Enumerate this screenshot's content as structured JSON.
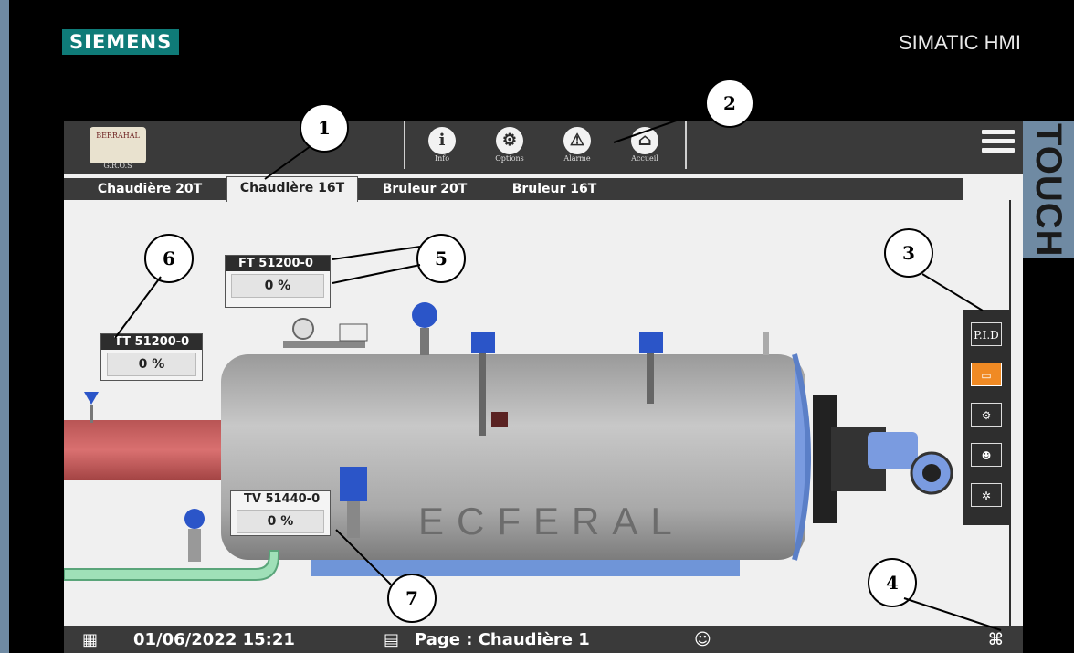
{
  "device": {
    "brand": "SIEMENS",
    "product": "SIMATIC HMI",
    "side_label": "TOUCH"
  },
  "header": {
    "logo_text": "BERRAHAL",
    "logo_sub": "G.R.O.S",
    "nav": [
      {
        "label": "Info",
        "icon": "info-icon"
      },
      {
        "label": "Options",
        "icon": "gear-icon"
      },
      {
        "label": "Alarme",
        "icon": "warning-icon"
      },
      {
        "label": "Accueil",
        "icon": "home-icon"
      }
    ]
  },
  "tabs": [
    {
      "label": "Chaudière 20T"
    },
    {
      "label": "Chaudière 16T",
      "active": true
    },
    {
      "label": "Bruleur 20T"
    },
    {
      "label": "Bruleur 16T"
    }
  ],
  "side_panel": [
    {
      "label": "P.I.D",
      "icon": "pid-icon"
    },
    {
      "label": "",
      "icon": "boiler-icon",
      "active": true
    },
    {
      "label": "",
      "icon": "burner-icon"
    },
    {
      "label": "",
      "icon": "operator-icon"
    },
    {
      "label": "",
      "icon": "conveyor-icon"
    }
  ],
  "tags": {
    "ft": {
      "name": "FT 51200-0",
      "value": "0 %"
    },
    "tt": {
      "name": "TT 51200-0",
      "value": "0 %"
    },
    "tv": {
      "name": "TV 51440-0",
      "value": "0 %"
    }
  },
  "boiler": {
    "label": "ECFERAL"
  },
  "status": {
    "datetime": "01/06/2022 15:21",
    "page": "Page : Chaudière 1"
  },
  "callouts": [
    "1",
    "2",
    "3",
    "4",
    "5",
    "6",
    "7"
  ],
  "colors": {
    "accent": "#f08a24",
    "valve_blue": "#2b55c8",
    "dark": "#3a3a3a",
    "brand": "#0f7b78"
  }
}
